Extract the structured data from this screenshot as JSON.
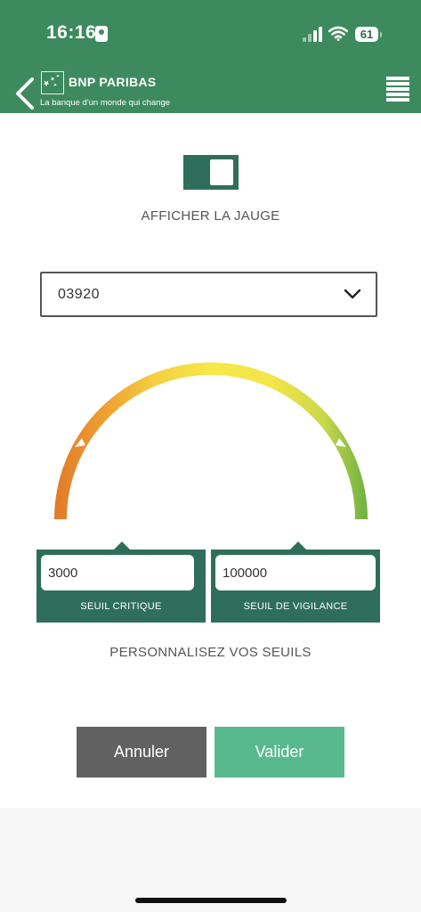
{
  "status_bar": {
    "time": "16:16",
    "battery": "61"
  },
  "header": {
    "brand": "BNP PARIBAS",
    "tagline": "La banque d'un monde qui change"
  },
  "gauge_toggle": {
    "label": "AFFICHER LA JAUGE",
    "state": "on"
  },
  "account_select": {
    "value": "03920"
  },
  "thresholds": {
    "critical": {
      "value": "3000",
      "label": "SEUIL CRITIQUE"
    },
    "vigilance": {
      "value": "100000",
      "label": "SEUIL DE VIGILANCE"
    }
  },
  "instructions": "PERSONNALISEZ VOS SEUILS",
  "buttons": {
    "cancel": "Annuler",
    "submit": "Valider"
  },
  "colors": {
    "header": "#3d8a5e",
    "toggle": "#2f6e5a",
    "cancel": "#616161",
    "submit": "#58b98f",
    "gauge_low": "#e07a2a",
    "gauge_mid": "#f6e84a",
    "gauge_high": "#6db043"
  }
}
